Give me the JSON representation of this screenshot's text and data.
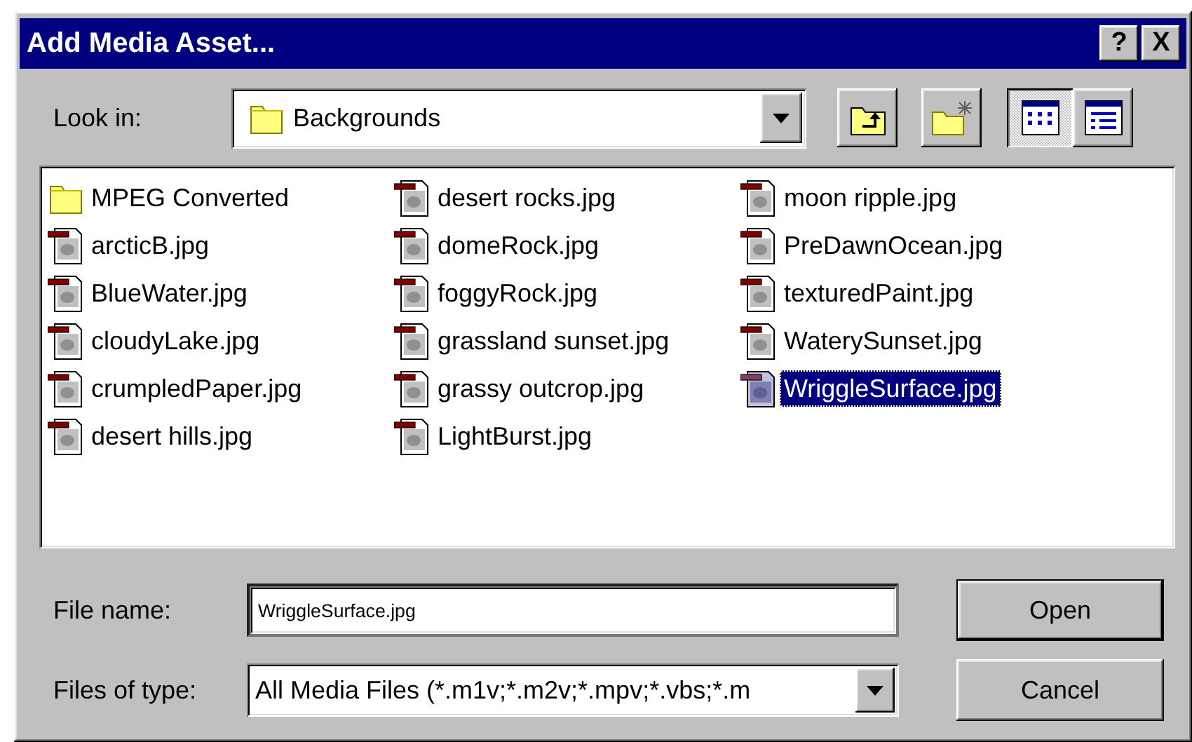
{
  "window": {
    "title": "Add Media Asset...",
    "controls": [
      "?",
      "X"
    ]
  },
  "look_in": {
    "label": "Look in:",
    "value": "Backgrounds"
  },
  "toolbar": [
    {
      "kind": "up-folder"
    },
    {
      "kind": "new-folder"
    }
  ],
  "view_buttons": [
    {
      "kind": "list",
      "selected": true
    },
    {
      "kind": "details",
      "selected": false
    }
  ],
  "files": [
    {
      "name": "MPEG Converted",
      "kind": "folder",
      "selected": false
    },
    {
      "name": "arcticB.jpg",
      "kind": "image",
      "selected": false
    },
    {
      "name": "BlueWater.jpg",
      "kind": "image",
      "selected": false
    },
    {
      "name": "cloudyLake.jpg",
      "kind": "image",
      "selected": false
    },
    {
      "name": "crumpledPaper.jpg",
      "kind": "image",
      "selected": false
    },
    {
      "name": "desert hills.jpg",
      "kind": "image",
      "selected": false
    },
    {
      "name": "desert rocks.jpg",
      "kind": "image",
      "selected": false
    },
    {
      "name": "domeRock.jpg",
      "kind": "image",
      "selected": false
    },
    {
      "name": "foggyRock.jpg",
      "kind": "image",
      "selected": false
    },
    {
      "name": "grassland sunset.jpg",
      "kind": "image",
      "selected": false
    },
    {
      "name": "grassy outcrop.jpg",
      "kind": "image",
      "selected": false
    },
    {
      "name": "LightBurst.jpg",
      "kind": "image",
      "selected": false
    },
    {
      "name": "moon ripple.jpg",
      "kind": "image",
      "selected": false
    },
    {
      "name": "PreDawnOcean.jpg",
      "kind": "image",
      "selected": false
    },
    {
      "name": "texturedPaint.jpg",
      "kind": "image",
      "selected": false
    },
    {
      "name": "WaterySunset.jpg",
      "kind": "image",
      "selected": false
    },
    {
      "name": "WriggleSurface.jpg",
      "kind": "image",
      "selected": true
    }
  ],
  "file_name": {
    "label": "File name:",
    "value": "WriggleSurface.jpg"
  },
  "file_type": {
    "label": "Files of type:",
    "value": "All Media Files (*.m1v;*.m2v;*.mpv;*.vbs;*.m"
  },
  "buttons": [
    {
      "label": "Open",
      "default": true
    },
    {
      "label": "Cancel",
      "default": false
    }
  ]
}
